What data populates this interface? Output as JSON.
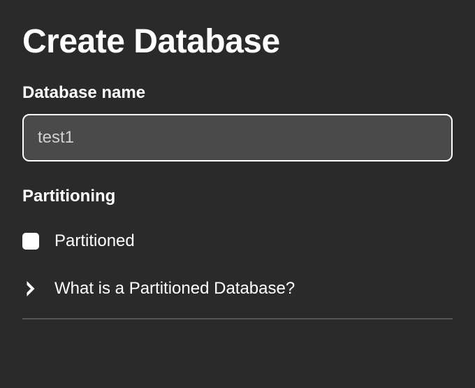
{
  "title": "Create Database",
  "fields": {
    "database_name": {
      "label": "Database name",
      "value": "test1"
    }
  },
  "partitioning": {
    "section_label": "Partitioning",
    "checkbox_label": "Partitioned",
    "checked": false,
    "help_label": "What is a Partitioned Database?"
  }
}
